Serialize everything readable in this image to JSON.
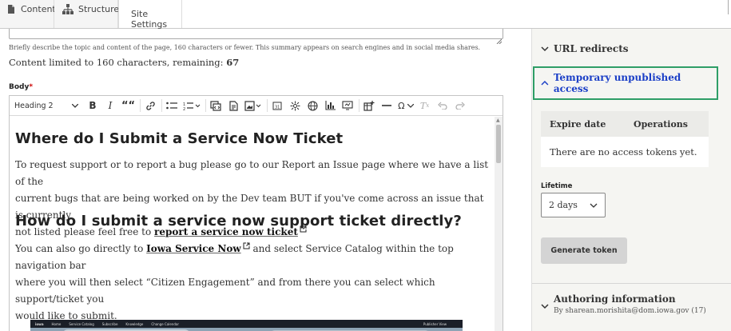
{
  "tabs": [
    {
      "label": "Content",
      "icon": "content-file-icon"
    },
    {
      "label": "Structure",
      "icon": "structure-tree-icon"
    },
    {
      "label": "Site Settings"
    }
  ],
  "summary": {
    "hint": "Briefly describe the topic and content of the page, 160 characters or fewer. This summary appears on search engines and in social media shares.",
    "limit_prefix": "Content limited to 160 characters, remaining: ",
    "limit_remaining": "67"
  },
  "body_field": {
    "label": "Body",
    "required_marker": "*"
  },
  "toolbar": {
    "heading_select": "Heading 2",
    "bold": "B",
    "italic": "I",
    "blockquote": "““",
    "special_chars": "Ω",
    "icons": [
      "link-icon",
      "bulleted-list-icon",
      "numbered-list-icon",
      "code-block-icon",
      "source-icon",
      "media-icon",
      "date-icon",
      "accordion-icon",
      "embed-icon",
      "chart-icon",
      "slideshow-icon",
      "insert-table-icon",
      "horizontal-line-icon",
      "special-characters-icon",
      "remove-format-icon",
      "undo-icon",
      "redo-icon"
    ]
  },
  "document": {
    "h1": "Where do I Submit a Service Now Ticket",
    "p1_lines": [
      "To request support or to report a bug please go to our Report an Issue page where we have a list of the",
      "current bugs that are being worked on by the Dev team BUT if you've come across an issue that is currently",
      "not listed please feel free to "
    ],
    "p1_link": "report a service now ticket",
    "h2": "How do I submit a service now support ticket directly?",
    "p2_start": "You can also go directly to ",
    "p2_link": "Iowa Service Now",
    "p2_rest_line1": " and select Service Catalog within the top navigation bar",
    "p2_lines": [
      "where you will then select “Citizen Engagement” and from there you can select which support/ticket you",
      "would like to submit."
    ],
    "image_nav": [
      "iowa",
      "Home",
      "Service Catalog",
      "Subscribe",
      "Knowledge",
      "Change Calendar",
      "Publisher View"
    ]
  },
  "sidebar": {
    "url_redirects": "URL redirects",
    "temp_access": "Temporary unpublished access",
    "table_headers": [
      "Expire date",
      "Operations"
    ],
    "empty_text": "There are no access tokens yet.",
    "lifetime_label": "Lifetime",
    "lifetime_value": "2 days",
    "generate_button": "Generate token",
    "authoring_title": "Authoring information",
    "authoring_sub": "By sharean.morishita@dom.iowa.gov (17)"
  },
  "colors": {
    "accent_link": "#1b3fc7",
    "focus_border": "#2e9e67",
    "required": "#cc0000"
  }
}
